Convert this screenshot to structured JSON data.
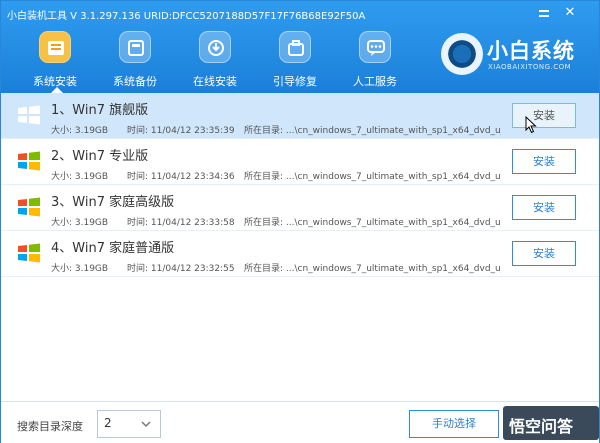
{
  "window": {
    "title": "小白装机工具 V 3.1.297.136 URID:DFCC5207188D57F17F76B68E92F50A"
  },
  "toolbar": {
    "items": [
      {
        "label": "系统安装",
        "icon": "system-install-icon",
        "active": true
      },
      {
        "label": "系统备份",
        "icon": "system-backup-icon",
        "active": false
      },
      {
        "label": "在线安装",
        "icon": "online-install-icon",
        "active": false
      },
      {
        "label": "引导修复",
        "icon": "boot-repair-icon",
        "active": false
      },
      {
        "label": "人工服务",
        "icon": "chat-service-icon",
        "active": false
      }
    ]
  },
  "brand": {
    "name": "小白系统",
    "subtitle": "XIAOBAIXITONG.COM"
  },
  "systems": [
    {
      "title": "1、Win7 旗舰版",
      "size": "大小: 3.19GB",
      "time": "时间: 11/04/12 23:35:39",
      "dir": "所在目录: ...\\cn_windows_7_ultimate_with_sp1_x64_dvd_u_",
      "button": "安装"
    },
    {
      "title": "2、Win7 专业版",
      "size": "大小: 3.19GB",
      "time": "时间: 11/04/12 23:34:36",
      "dir": "所在目录: ...\\cn_windows_7_ultimate_with_sp1_x64_dvd_u_",
      "button": "安装"
    },
    {
      "title": "3、Win7 家庭高级版",
      "size": "大小: 3.19GB",
      "time": "时间: 11/04/12 23:33:58",
      "dir": "所在目录: ...\\cn_windows_7_ultimate_with_sp1_x64_dvd_u_",
      "button": "安装"
    },
    {
      "title": "4、Win7 家庭普通版",
      "size": "大小: 3.19GB",
      "time": "时间: 11/04/12 23:32:55",
      "dir": "所在目录: ...\\cn_windows_7_ultimate_with_sp1_x64_dvd_u_",
      "button": "安装"
    }
  ],
  "footer": {
    "depth_label": "搜索目录深度",
    "depth_value": "2",
    "manual_button": "手动选择",
    "watermark": "悟空问答"
  },
  "colors": {
    "header": "#1b7fd9",
    "accent": "#2f8de0",
    "selected_row": "#cfe6fb",
    "active_tool": "#f7c046"
  }
}
